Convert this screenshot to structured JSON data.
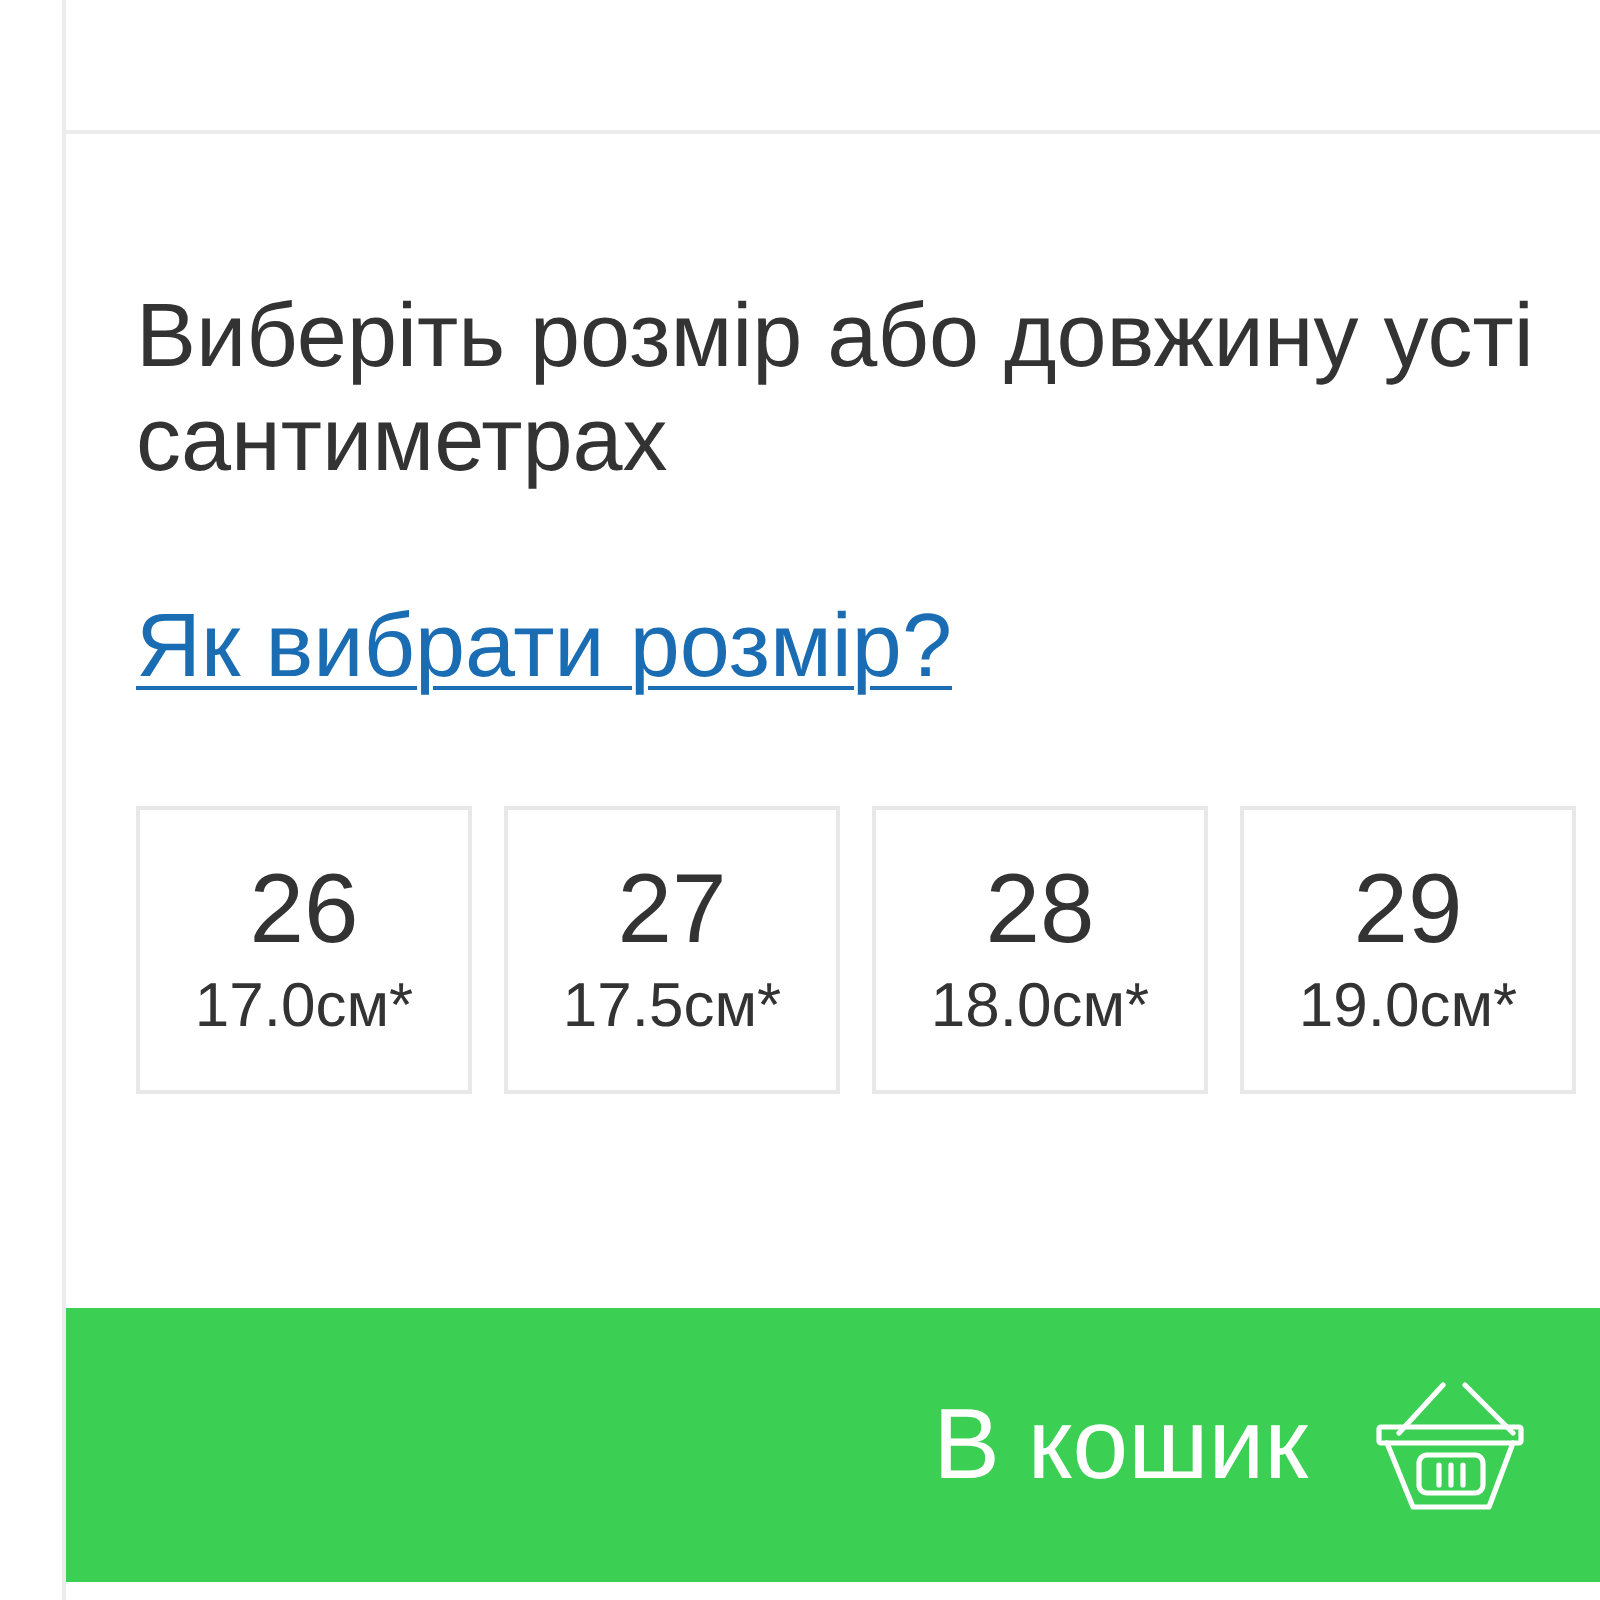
{
  "size_prompt": {
    "lines": [
      "Виберіть розмір або довжину усті",
      "сантиметрах"
    ]
  },
  "size_guide_link": "Як вибрати розмір?",
  "sizes": [
    {
      "size": "26",
      "length": "17.0см*",
      "selected": false
    },
    {
      "size": "27",
      "length": "17.5см*",
      "selected": false
    },
    {
      "size": "28",
      "length": "18.0см*",
      "selected": false
    },
    {
      "size": "29",
      "length": "19.0см*",
      "selected": false
    }
  ],
  "add_to_cart_button": {
    "label": "В кошик"
  }
}
